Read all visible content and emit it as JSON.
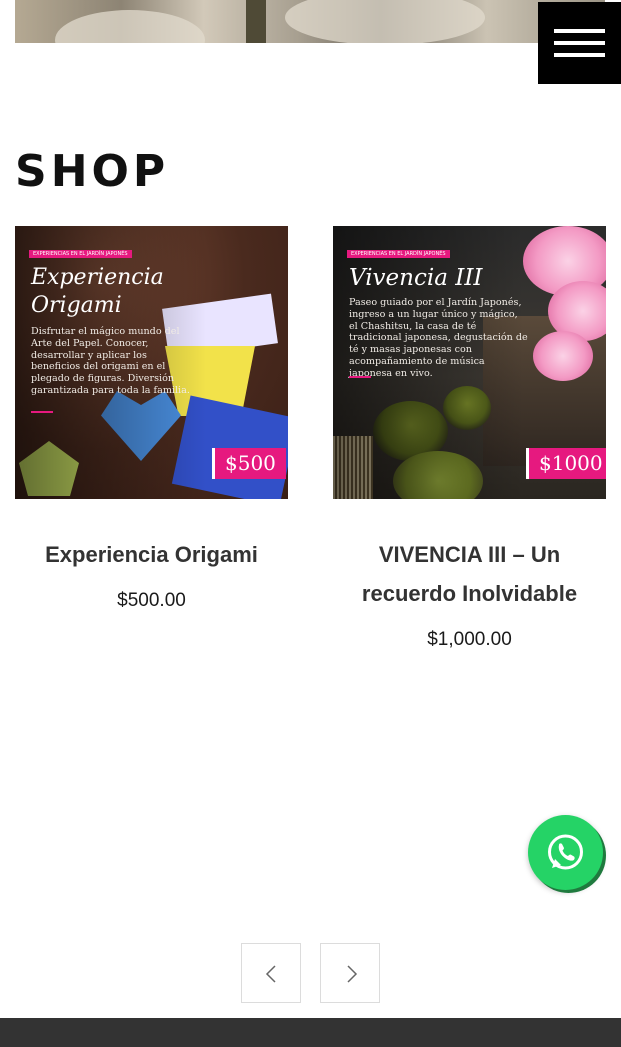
{
  "header": {
    "menu_icon": "hamburger-menu-icon"
  },
  "shop": {
    "title": "SHOP",
    "products": [
      {
        "image": {
          "tag": "EXPERIENCIAS EN EL JARDÍN JAPONÉS",
          "title_line1": "Experiencia",
          "title_line2": "Origami",
          "description": "Disfrutar el mágico mundo del Arte del Papel. Conocer, desarrollar y aplicar los beneficios del origami en el plegado de figuras. Diversión garantizada para toda la familia.",
          "price_tag": "$500"
        },
        "name": "Experiencia Origami",
        "price": "$500.00"
      },
      {
        "image": {
          "tag": "EXPERIENCIAS EN EL JARDÍN JAPONÉS",
          "title": "Vivencia III",
          "description": "Paseo guiado por el Jardín Japonés, ingreso a un lugar único y mágico, el Chashitsu, la casa de té tradicional japonesa, degustación de té y masas japonesas con acompañamiento de música japonesa en vivo.",
          "price_tag": "$1000"
        },
        "name": "VIVENCIA III – Un recuerdo Inolvidable",
        "price": "$1,000.00"
      }
    ]
  },
  "pager": {
    "prev_icon": "chevron-left-icon",
    "next_icon": "chevron-right-icon"
  },
  "whatsapp": {
    "icon": "whatsapp-icon",
    "color": "#25d366"
  },
  "colors": {
    "accent": "#e6197f",
    "footer": "#333333",
    "menu_bg": "#000000"
  }
}
